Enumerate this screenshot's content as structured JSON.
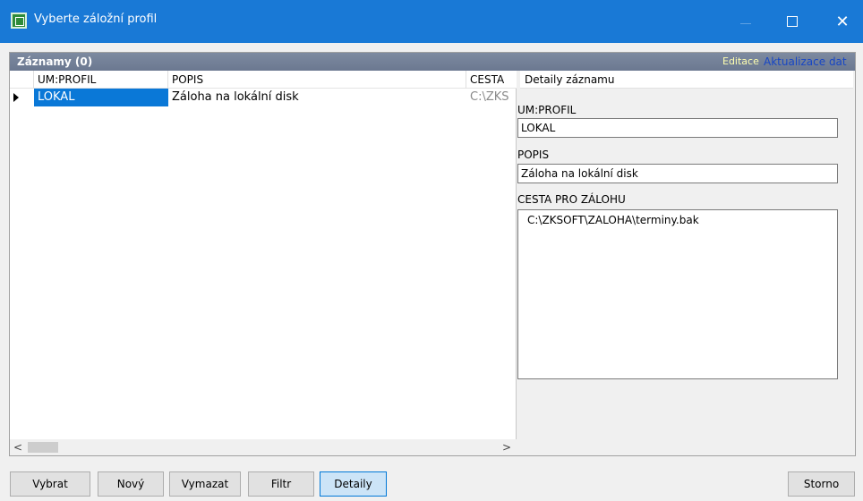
{
  "window": {
    "title": "Vyberte záložní profil"
  },
  "panel": {
    "caption": "Záznamy (0)",
    "link_edit": "Editace",
    "link_update": "Aktualizace dat"
  },
  "grid": {
    "columns": [
      "UM:PROFIL",
      "POPIS",
      "CESTA"
    ],
    "rows": [
      {
        "profil": "LOKAL",
        "popis": "Záloha na lokální disk",
        "cesta": "C:\\ZKS"
      }
    ]
  },
  "detail": {
    "header": "Detaily záznamu",
    "profil_label": "UM:PROFIL",
    "profil_value": "LOKAL",
    "popis_label": "POPIS",
    "popis_value": "Záloha na lokální disk",
    "cesta_label": "CESTA PRO ZÁLOHU",
    "cesta_value": "C:\\ZKSOFT\\ZALOHA\\terminy.bak"
  },
  "buttons": {
    "vybrat": "Vybrat",
    "novy": "Nový",
    "vymazat": "Vymazat",
    "filtr": "Filtr",
    "detaily": "Detaily",
    "storno": "Storno"
  },
  "colors": {
    "titlebar": "#1979d6",
    "selection": "#0a78d7",
    "panel_header": "#6b7890"
  }
}
